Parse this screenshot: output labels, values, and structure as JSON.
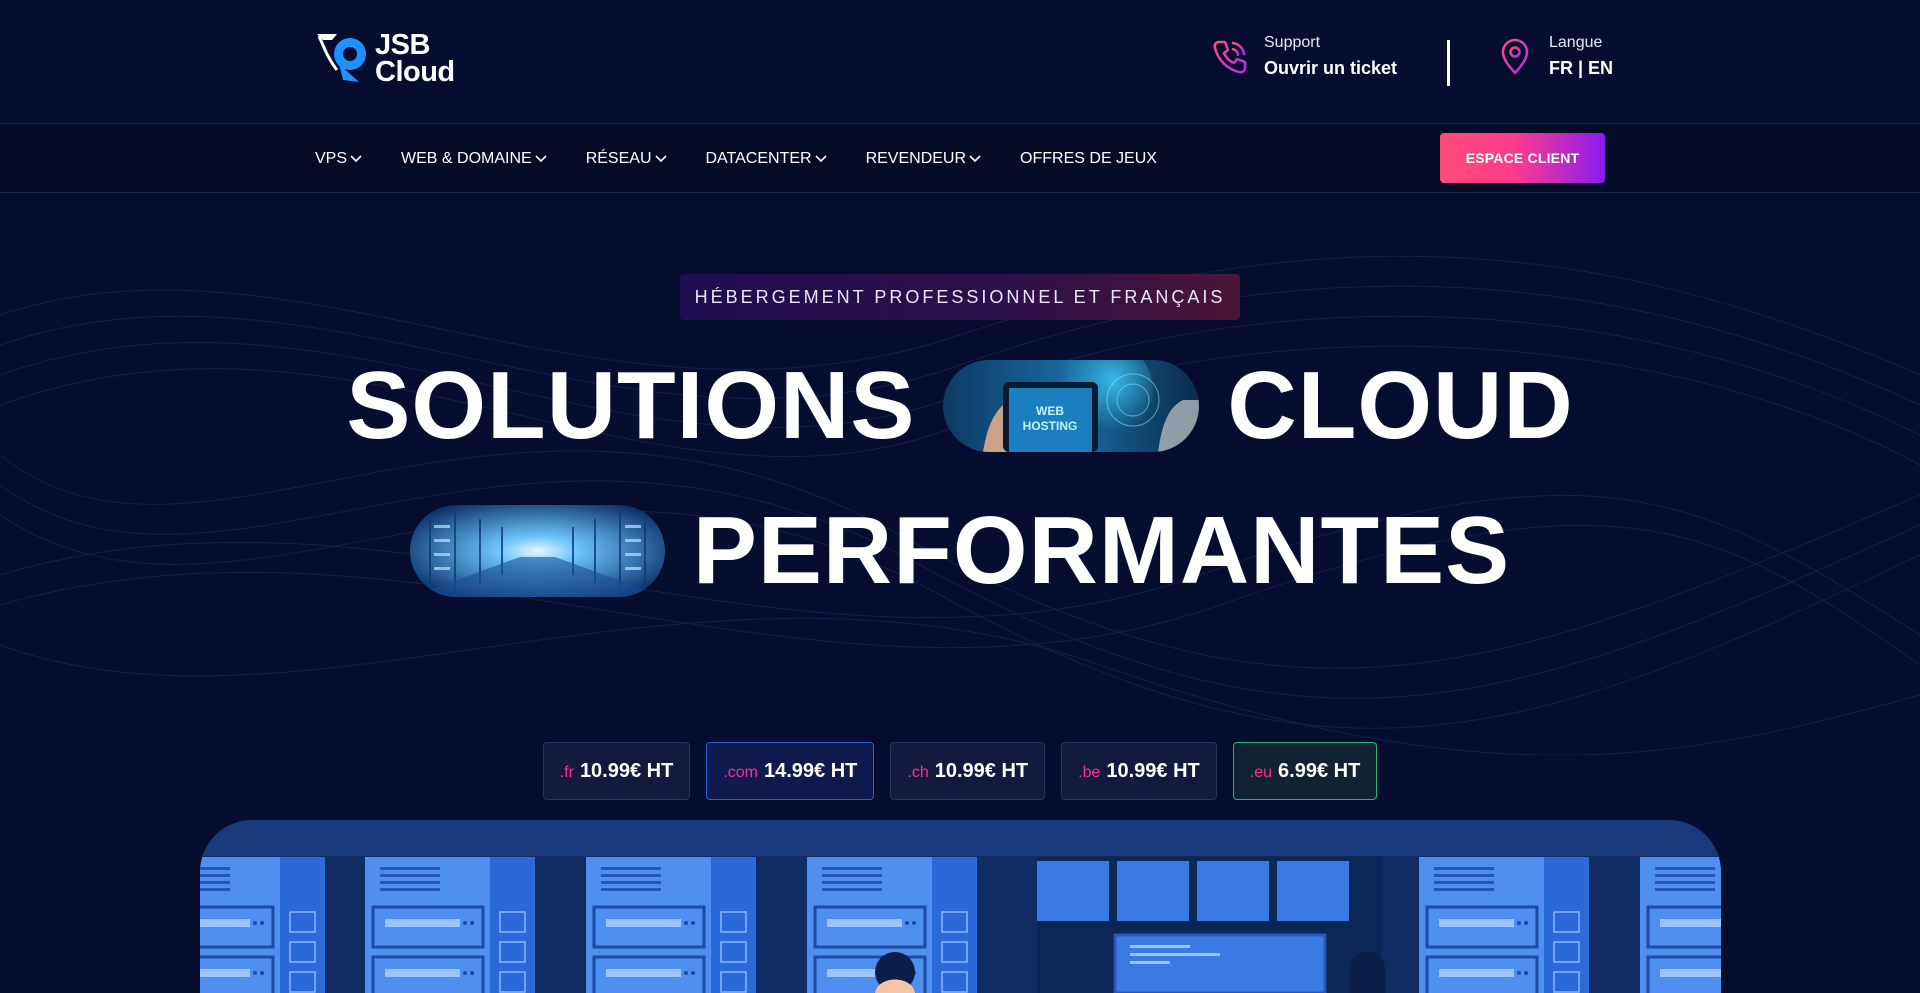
{
  "brand": {
    "logo_line1": "JSB",
    "logo_line2": "Cloud"
  },
  "header": {
    "support": {
      "label": "Support",
      "value": "Ouvrir un ticket"
    },
    "language": {
      "label": "Langue",
      "value": "FR | EN"
    }
  },
  "nav": {
    "items": [
      {
        "label": "VPS",
        "has_menu": true
      },
      {
        "label": "WEB & DOMAINE",
        "has_menu": true
      },
      {
        "label": "RÉSEAU",
        "has_menu": true
      },
      {
        "label": "DATACENTER",
        "has_menu": true
      },
      {
        "label": "REVENDEUR",
        "has_menu": true
      },
      {
        "label": "OFFRES DE JEUX",
        "has_menu": false
      }
    ],
    "cta_label": "ESPACE CLIENT"
  },
  "hero": {
    "badge": "HÉBERGEMENT PROFESSIONNEL ET FRANÇAIS",
    "word1": "SOLUTIONS",
    "word2": "CLOUD",
    "word3": "PERFORMANTES",
    "pill1_caption_line1": "WEB",
    "pill1_caption_line2": "HOSTING"
  },
  "domains": [
    {
      "ext": ".fr",
      "price": "10.99€ HT"
    },
    {
      "ext": ".com",
      "price": "14.99€ HT"
    },
    {
      "ext": ".ch",
      "price": "10.99€ HT"
    },
    {
      "ext": ".be",
      "price": "10.99€ HT"
    },
    {
      "ext": ".eu",
      "price": "6.99€ HT"
    }
  ],
  "colors": {
    "background": "#070d2e",
    "accent_pink": "#ff2e8c",
    "cta_gradient_start": "#ff4d79",
    "cta_gradient_end": "#8a1cf0",
    "logo_blue": "#1e90ff"
  },
  "icons": {
    "support": "phone-icon",
    "language": "location-pin-icon",
    "menu": "chevron-down-icon"
  }
}
